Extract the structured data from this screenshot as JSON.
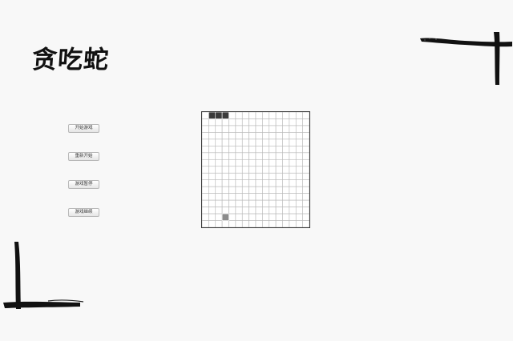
{
  "app": {
    "title": "贪吃蛇"
  },
  "controls": {
    "start_label": "开始游戏",
    "restart_label": "重新开始",
    "pause_label": "游戏暂停",
    "resume_label": "游戏继续"
  },
  "board": {
    "cols": 16,
    "rows": 17,
    "grid_color": "#b8b8b8",
    "snake_color": "#3a3a3a",
    "food_color": "#8c8c8c",
    "snake": [
      [
        1,
        0
      ],
      [
        2,
        0
      ],
      [
        3,
        0
      ]
    ],
    "food": [
      3,
      15
    ]
  }
}
